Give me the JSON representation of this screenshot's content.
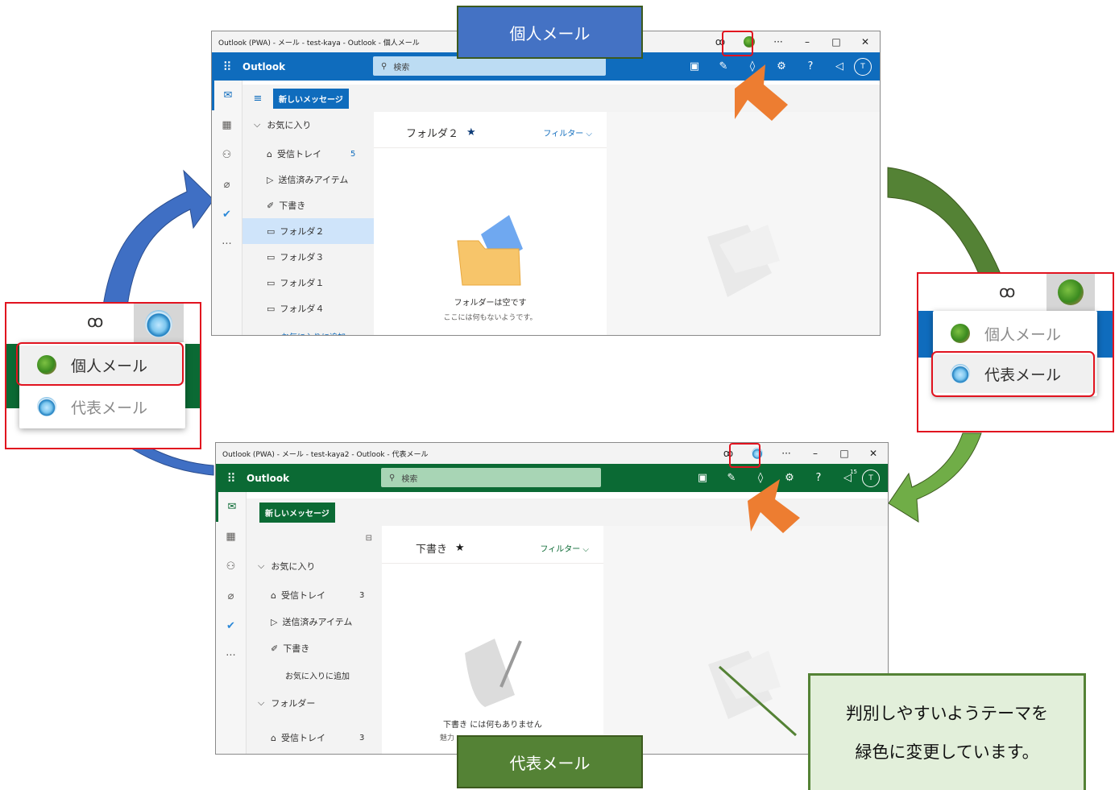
{
  "top_window": {
    "title": "Outlook (PWA) - メール - test-kaya - Outlook - 個人メール",
    "window_controls": {
      "link": "ꝏ",
      "more": "···",
      "minimize": "–",
      "maximize": "□",
      "close": "✕"
    },
    "theme_color": "#0f6cbd",
    "app_name": "Outlook",
    "search_placeholder": "検索",
    "account_initial": "T",
    "new_message_label": "新しいメッセージ",
    "nav": {
      "favorites_label": "お気に入り",
      "items": [
        {
          "label": "受信トレイ",
          "count": "5"
        },
        {
          "label": "送信済みアイテム",
          "count": ""
        },
        {
          "label": "下書き",
          "count": ""
        },
        {
          "label": "フォルダ２",
          "count": ""
        },
        {
          "label": "フォルダ３",
          "count": ""
        },
        {
          "label": "フォルダ１",
          "count": ""
        },
        {
          "label": "フォルダ４",
          "count": ""
        }
      ],
      "add_favorite_label": "お気に入りに追加"
    },
    "list_header": "フォルダ２",
    "filter_label": "フィルター",
    "empty_title": "フォルダーは空です",
    "empty_sub": "ここには何もないようです。"
  },
  "bottom_window": {
    "title": "Outlook (PWA) - メール - test-kaya2 - Outlook - 代表メール",
    "window_controls": {
      "link": "ꝏ",
      "more": "···",
      "minimize": "–",
      "maximize": "□",
      "close": "✕"
    },
    "theme_color": "#0b6a34",
    "app_name": "Outlook",
    "search_placeholder": "検索",
    "account_initial": "T",
    "notification_badge": "15",
    "new_message_label": "新しいメッセージ",
    "nav": {
      "favorites_label": "お気に入り",
      "items": [
        {
          "label": "受信トレイ",
          "count": "3"
        },
        {
          "label": "送信済みアイテム",
          "count": ""
        },
        {
          "label": "下書き",
          "count": ""
        }
      ],
      "add_favorite_label": "お気に入りに追加",
      "folders_label": "フォルダー",
      "folder_items": [
        {
          "label": "受信トレイ",
          "count": "3"
        }
      ]
    },
    "list_header": "下書き",
    "filter_label": "フィルター",
    "empty_title": "下書き には何もありません",
    "empty_sub": "魅力"
  },
  "callouts": {
    "personal": "個人メール",
    "representative": "代表メール",
    "note_line1": "判別しやすいようテーマを",
    "note_line2": "緑色に変更しています。"
  },
  "left_popout": {
    "link_glyph": "ꝏ",
    "items": [
      "個人メール",
      "代表メール"
    ]
  },
  "right_popout": {
    "link_glyph": "ꝏ",
    "items": [
      "個人メール",
      "代表メール"
    ]
  },
  "colors": {
    "blue_theme": "#0f6cbd",
    "green_theme": "#0b6a34",
    "callout_blue": "#4472c4",
    "callout_green": "#548235",
    "note_fill": "#e2efda",
    "highlight_red": "#e1131f",
    "arrow_orange": "#ed7d31"
  }
}
